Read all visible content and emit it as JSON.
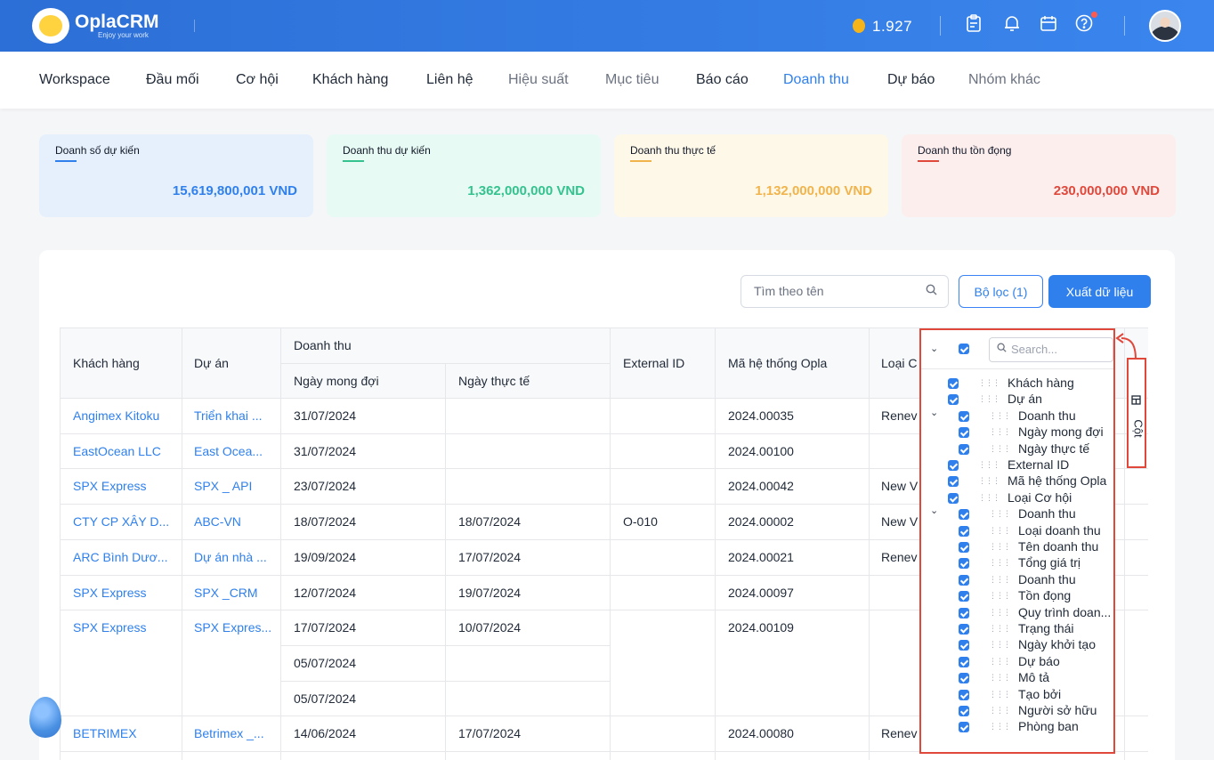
{
  "app": {
    "name": "OplaCRM",
    "tagline": "Enjoy your work",
    "coins": "1.927"
  },
  "nav": {
    "items": [
      "Workspace",
      "Đầu mối",
      "Cơ hội",
      "Khách hàng",
      "Liên hệ",
      "Hiệu suất",
      "Mục tiêu",
      "Báo cáo",
      "Doanh thu",
      "Dự báo",
      "Nhóm khác"
    ],
    "active": "Doanh thu"
  },
  "stats": [
    {
      "label": "Doanh số dự kiến",
      "value": "15,619,800,001 VND",
      "bg": "#e6f0fd",
      "color": "#2f80ed"
    },
    {
      "label": "Doanh thu dự kiến",
      "value": "1,362,000,000 VND",
      "bg": "#e7faf3",
      "color": "#34c38f"
    },
    {
      "label": "Doanh thu thực tế",
      "value": "1,132,000,000 VND",
      "bg": "#fef8e8",
      "color": "#f1b44c"
    },
    {
      "label": "Doanh thu tồn đọng",
      "value": "230,000,000 VND",
      "bg": "#fdeeee",
      "color": "#e0483b"
    }
  ],
  "toolbar": {
    "search_placeholder": "Tìm theo tên",
    "filter_label": "Bộ lọc (1)",
    "export_label": "Xuất dữ liệu"
  },
  "table": {
    "headers": {
      "customer": "Khách hàng",
      "project": "Dự án",
      "revenue_group": "Doanh thu",
      "expected_date": "Ngày mong đợi",
      "actual_date": "Ngày thực tế",
      "external_id": "External ID",
      "opla_code": "Mã hệ thống Opla",
      "deal_type": "Loại C"
    },
    "rows": [
      {
        "customer": "Angimex Kitoku",
        "project": "Triển khai ...",
        "subrows": [
          {
            "expected": "31/07/2024",
            "actual": ""
          }
        ],
        "external_id": "",
        "code": "2024.00035",
        "type": "Renev"
      },
      {
        "customer": "EastOcean LLC",
        "project": "East Ocea...",
        "subrows": [
          {
            "expected": "31/07/2024",
            "actual": ""
          }
        ],
        "external_id": "",
        "code": "2024.00100",
        "type": ""
      },
      {
        "customer": "SPX Express",
        "project": "SPX _ API",
        "subrows": [
          {
            "expected": "23/07/2024",
            "actual": ""
          }
        ],
        "external_id": "",
        "code": "2024.00042",
        "type": "New V"
      },
      {
        "customer": "CTY CP XÂY D...",
        "project": "ABC-VN",
        "subrows": [
          {
            "expected": "18/07/2024",
            "actual": "18/07/2024"
          }
        ],
        "external_id": "O-010",
        "code": "2024.00002",
        "type": "New V"
      },
      {
        "customer": "ARC Bình Dươ...",
        "project": "Dự án nhà ...",
        "subrows": [
          {
            "expected": "19/09/2024",
            "actual": "17/07/2024"
          }
        ],
        "external_id": "",
        "code": "2024.00021",
        "type": "Renev"
      },
      {
        "customer": "SPX Express",
        "project": "SPX _CRM",
        "subrows": [
          {
            "expected": "12/07/2024",
            "actual": "19/07/2024"
          }
        ],
        "external_id": "",
        "code": "2024.00097",
        "type": ""
      },
      {
        "customer": "SPX Express",
        "project": "SPX Expres...",
        "subrows": [
          {
            "expected": "17/07/2024",
            "actual": "10/07/2024"
          },
          {
            "expected": "05/07/2024",
            "actual": ""
          },
          {
            "expected": "05/07/2024",
            "actual": ""
          }
        ],
        "external_id": "",
        "code": "2024.00109",
        "type": ""
      },
      {
        "customer": "BETRIMEX",
        "project": "Betrimex _...",
        "subrows": [
          {
            "expected": "14/06/2024",
            "actual": "17/07/2024"
          }
        ],
        "external_id": "",
        "code": "2024.00080",
        "type": "Renev"
      }
    ]
  },
  "column_chooser": {
    "search_placeholder": "Search...",
    "tab_label": "Cột",
    "items": [
      {
        "label": "Khách hàng",
        "level": 0,
        "caret": false
      },
      {
        "label": "Dự án",
        "level": 0,
        "caret": false
      },
      {
        "label": "Doanh thu",
        "level": 1,
        "caret": true
      },
      {
        "label": "Ngày mong đợi",
        "level": 1,
        "caret": false
      },
      {
        "label": "Ngày thực tế",
        "level": 1,
        "caret": false
      },
      {
        "label": "External ID",
        "level": 0,
        "caret": false
      },
      {
        "label": "Mã hệ thống Opla",
        "level": 0,
        "caret": false
      },
      {
        "label": "Loại Cơ hội",
        "level": 0,
        "caret": false
      },
      {
        "label": "Doanh thu",
        "level": 1,
        "caret": true
      },
      {
        "label": "Loại doanh thu",
        "level": 1,
        "caret": false
      },
      {
        "label": "Tên doanh thu",
        "level": 1,
        "caret": false
      },
      {
        "label": "Tổng giá trị",
        "level": 1,
        "caret": false
      },
      {
        "label": "Doanh thu",
        "level": 1,
        "caret": false
      },
      {
        "label": "Tồn đọng",
        "level": 1,
        "caret": false
      },
      {
        "label": "Quy trình doan...",
        "level": 1,
        "caret": false
      },
      {
        "label": "Trạng thái",
        "level": 1,
        "caret": false
      },
      {
        "label": "Ngày khởi tạo",
        "level": 1,
        "caret": false
      },
      {
        "label": "Dự báo",
        "level": 1,
        "caret": false
      },
      {
        "label": "Mô tả",
        "level": 1,
        "caret": false
      },
      {
        "label": "Tạo bởi",
        "level": 1,
        "caret": false
      },
      {
        "label": "Người sở hữu",
        "level": 1,
        "caret": false
      },
      {
        "label": "Phòng ban",
        "level": 1,
        "caret": false
      }
    ]
  }
}
